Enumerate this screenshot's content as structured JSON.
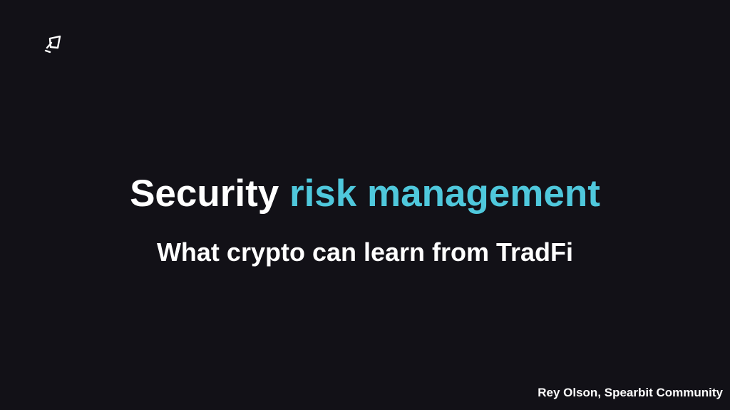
{
  "colors": {
    "background": "#121117",
    "text": "#ffffff",
    "accent": "#4fc8dc"
  },
  "logo": {
    "icon": "spearbit-logo-icon"
  },
  "title": {
    "part1": "Security",
    "part2": "risk management"
  },
  "subtitle": "What crypto can learn from TradFi",
  "author": "Rey Olson, Spearbit Community"
}
